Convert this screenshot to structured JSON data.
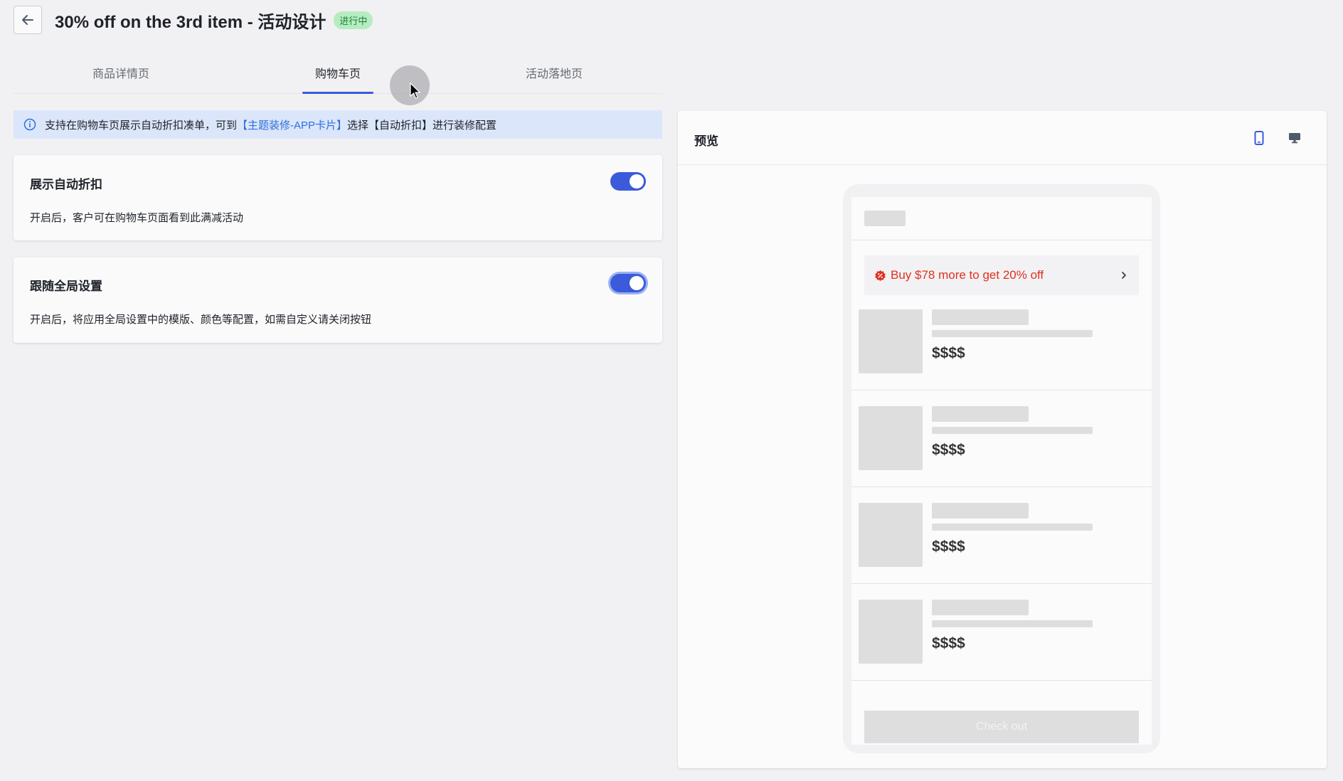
{
  "header": {
    "title": "30% off on the 3rd item - 活动设计",
    "status": "进行中"
  },
  "tabs": [
    {
      "label": "商品详情页"
    },
    {
      "label": "购物车页"
    },
    {
      "label": "活动落地页"
    }
  ],
  "notice": {
    "prefix": "支持在购物车页展示自动折扣凑单，可到",
    "link": "【主题装修-APP卡片】",
    "suffix": "选择【自动折扣】进行装修配置"
  },
  "settings": [
    {
      "title": "展示自动折扣",
      "description": "开启后，客户可在购物车页面看到此满减活动",
      "enabled": true
    },
    {
      "title": "跟随全局设置",
      "description": "开启后，将应用全局设置中的模版、颜色等配置，如需自定义请关闭按钮",
      "enabled": true
    }
  ],
  "preview": {
    "title": "预览",
    "promo_text": "Buy $78 more to get 20% off",
    "item_prices": [
      "$$$$",
      "$$$$",
      "$$$$",
      "$$$$"
    ],
    "checkout_label": "Check out"
  },
  "colors": {
    "accent": "#3b5bdb",
    "status_badge_bg": "#b6ecc1",
    "promo_red": "#e0301e",
    "notice_bg": "#dbe6fb",
    "link": "#2f6fdb"
  },
  "icons": {
    "back": "arrow-left-icon",
    "info": "info-circle-icon",
    "mobile": "mobile-device-icon",
    "desktop": "desktop-monitor-icon",
    "promo": "discount-badge-icon",
    "chevron": "chevron-right-icon"
  }
}
